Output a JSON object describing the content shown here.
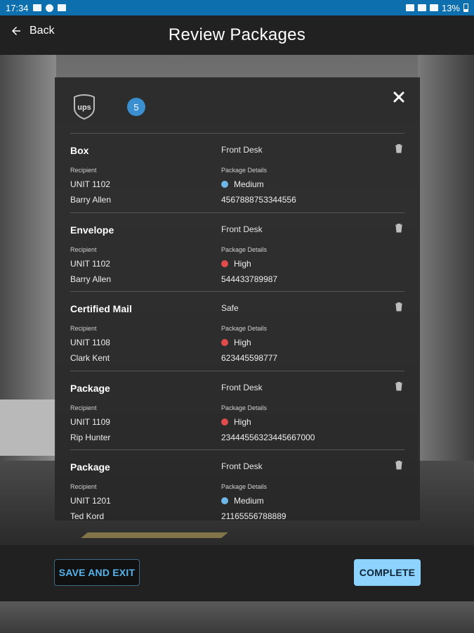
{
  "status_bar": {
    "time": "17:34",
    "battery": "13%"
  },
  "header": {
    "back_label": "Back",
    "title": "Review Packages"
  },
  "modal": {
    "carrier_icon": "ups-logo",
    "package_count": "5",
    "packages": [
      {
        "type": "Box",
        "location": "Front Desk",
        "recipient_label": "Recipient",
        "details_label": "Package Details",
        "unit": "UNIT 1102",
        "name": "Barry Allen",
        "priority": "Medium",
        "priority_color": "#6fb7e8",
        "tracking": "4567888753344556"
      },
      {
        "type": "Envelope",
        "location": "Front Desk",
        "recipient_label": "Recipient",
        "details_label": "Package Details",
        "unit": "UNIT 1102",
        "name": "Barry Allen",
        "priority": "High",
        "priority_color": "#e04b4b",
        "tracking": "544433789987"
      },
      {
        "type": "Certified Mail",
        "location": "Safe",
        "recipient_label": "Recipient",
        "details_label": "Package Details",
        "unit": "UNIT 1108",
        "name": "Clark Kent",
        "priority": "High",
        "priority_color": "#e04b4b",
        "tracking": "623445598777"
      },
      {
        "type": "Package",
        "location": "Front Desk",
        "recipient_label": "Recipient",
        "details_label": "Package Details",
        "unit": "UNIT 1109",
        "name": "Rip Hunter",
        "priority": "High",
        "priority_color": "#e04b4b",
        "tracking": "23444556323445667000"
      },
      {
        "type": "Package",
        "location": "Front Desk",
        "recipient_label": "Recipient",
        "details_label": "Package Details",
        "unit": "UNIT 1201",
        "name": "Ted Kord",
        "priority": "Medium",
        "priority_color": "#6fb7e8",
        "tracking": "21165556788889"
      }
    ]
  },
  "footer": {
    "save_label": "SAVE AND EXIT",
    "complete_label": "COMPLETE"
  },
  "colors": {
    "accent": "#3a8fd1",
    "status_bar": "#0d6fae",
    "header": "#212121",
    "complete_bg": "#8dd3ff"
  }
}
